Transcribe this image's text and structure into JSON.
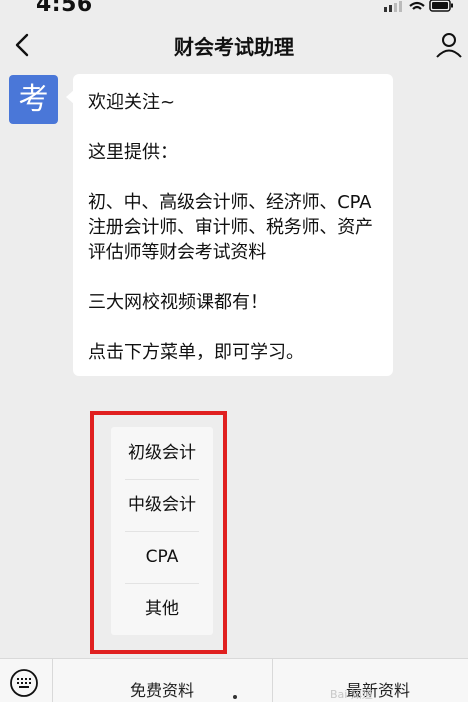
{
  "status_bar": {
    "time": "4:56"
  },
  "nav": {
    "title": "财会考试助理"
  },
  "avatar": {
    "text": "考",
    "color": "#4a77d8"
  },
  "message": {
    "paragraphs": [
      "欢迎关注~",
      "这里提供：",
      "初、中、高级会计师、经济师、CPA 注册会计师、审计师、税务师、资产评估师等财会考试资料",
      "三大网校视频课都有！",
      "点击下方菜单，即可学习。"
    ]
  },
  "submenu": {
    "items": [
      {
        "label": "初级会计"
      },
      {
        "label": "中级会计"
      },
      {
        "label": "CPA"
      },
      {
        "label": "其他"
      }
    ],
    "highlight_color": "#e02020"
  },
  "bottom_menu": {
    "items": [
      {
        "label": "免费资料"
      },
      {
        "label": "最新资料"
      }
    ]
  },
  "watermark": {
    "text": "Bai 知道"
  },
  "icons": [
    "back-chevron-icon",
    "profile-icon",
    "keyboard-icon"
  ]
}
